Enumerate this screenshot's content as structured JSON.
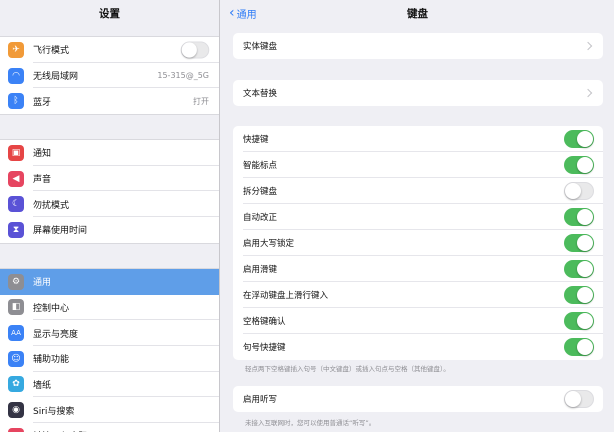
{
  "sidebar": {
    "title": "设置",
    "groups": [
      [
        {
          "label": "飞行模式",
          "icon": "airplane-icon",
          "color": "#f19a38",
          "glyph": "✈",
          "toggle": false
        },
        {
          "label": "无线局域网",
          "icon": "wifi-icon",
          "color": "#3b82f6",
          "glyph": "◠",
          "value": "15-315@_5G"
        },
        {
          "label": "蓝牙",
          "icon": "bluetooth-icon",
          "color": "#3b82f6",
          "glyph": "ᛒ",
          "value": "打开"
        }
      ],
      [
        {
          "label": "通知",
          "icon": "notification-icon",
          "color": "#e64545",
          "glyph": "▣"
        },
        {
          "label": "声音",
          "icon": "sound-icon",
          "color": "#e64560",
          "glyph": "◀"
        },
        {
          "label": "勿扰模式",
          "icon": "moon-icon",
          "color": "#5a52d6",
          "glyph": "☾"
        },
        {
          "label": "屏幕使用时间",
          "icon": "hourglass-icon",
          "color": "#5a52d6",
          "glyph": "⧗"
        }
      ],
      [
        {
          "label": "通用",
          "icon": "gear-icon",
          "color": "#8e8e93",
          "glyph": "⚙",
          "selected": true
        },
        {
          "label": "控制中心",
          "icon": "control-center-icon",
          "color": "#8e8e93",
          "glyph": "◧"
        },
        {
          "label": "显示与亮度",
          "icon": "display-icon",
          "color": "#3b82f6",
          "glyph": "AA"
        },
        {
          "label": "辅助功能",
          "icon": "accessibility-icon",
          "color": "#3b82f6",
          "glyph": "☺"
        },
        {
          "label": "墙纸",
          "icon": "wallpaper-icon",
          "color": "#36a9e0",
          "glyph": "✿"
        },
        {
          "label": "Siri与搜索",
          "icon": "siri-icon",
          "color": "#333344",
          "glyph": "◉"
        },
        {
          "label": "触控ID与密码",
          "icon": "touch-id-icon",
          "color": "#e64560",
          "glyph": "◎"
        }
      ]
    ]
  },
  "nav": {
    "back_label": "通用",
    "title": "键盘"
  },
  "sections": {
    "physical": [
      {
        "label": "实体键盘"
      }
    ],
    "replace": [
      {
        "label": "文本替换"
      }
    ],
    "toggles": [
      {
        "label": "快捷键",
        "on": true
      },
      {
        "label": "智能标点",
        "on": true
      },
      {
        "label": "拆分键盘",
        "on": false
      },
      {
        "label": "自动改正",
        "on": true
      },
      {
        "label": "启用大写锁定",
        "on": true
      },
      {
        "label": "启用滑键",
        "on": true
      },
      {
        "label": "在浮动键盘上滑行键入",
        "on": true
      },
      {
        "label": "空格键确认",
        "on": true
      },
      {
        "label": "句号快捷键",
        "on": true
      }
    ],
    "toggles_note": "轻点两下空格键插入句号（中文键盘）或插入句点与空格（其他键盘）。",
    "dictation": [
      {
        "label": "启用听写",
        "on": false
      }
    ],
    "dictation_note": "未接入互联网时，您可以使用普通话“听写”。"
  },
  "colors": {
    "accent": "#2f7cf6",
    "toggle_on": "#4cbb5c",
    "selected": "#5f9ee8"
  }
}
